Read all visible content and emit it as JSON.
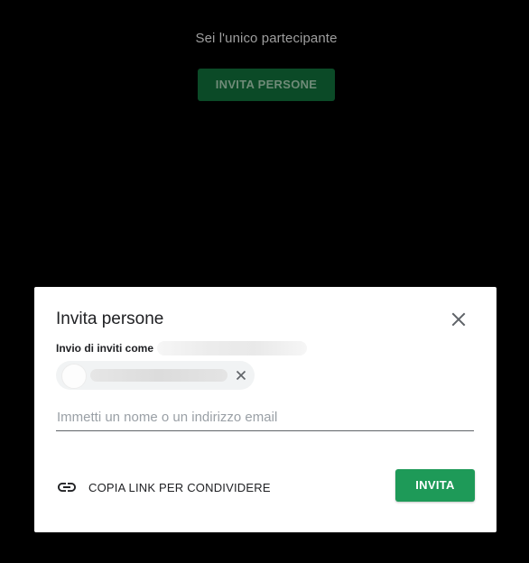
{
  "call": {
    "status_text": "Sei l'unico partecipante",
    "invite_button_label": "INVITA PERSONE"
  },
  "dialog": {
    "title": "Invita persone",
    "sender_label": "Invio di inviti come",
    "close_icon": "close-icon",
    "chip_remove_icon": "close-icon",
    "input_placeholder": "Immetti un nome o un indirizzo email",
    "input_value": "",
    "copy_link_icon": "link-icon",
    "copy_link_label": "COPIA LINK PER CONDIVIDERE",
    "invite_label": "INVITA"
  },
  "colors": {
    "page_background": "#000000",
    "dialog_background": "#ffffff",
    "primary_green": "#1e9a58",
    "dim_green": "#0b4a27"
  }
}
